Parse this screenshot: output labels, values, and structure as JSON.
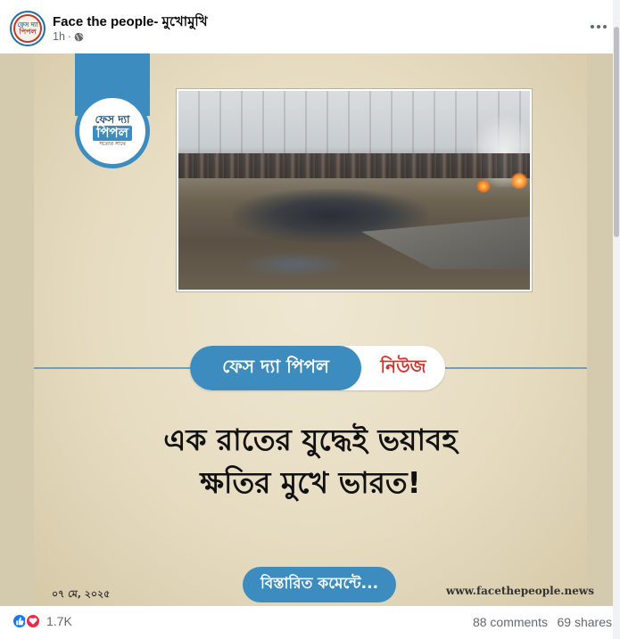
{
  "post": {
    "page_name": "Face the people- মুখোমুখি",
    "time": "1h",
    "audience_icon": "globe-icon",
    "more_icon": "more-options-icon"
  },
  "image": {
    "logo": {
      "line1": "ফেস দ্যা",
      "line2": "পিপল",
      "line3": "সত্যের সাথে"
    },
    "news_label_left": "ফেস দ্যা পিপল",
    "news_label_right": "নিউজ",
    "headline_line1": "এক রাতের যুদ্ধেই ভয়াবহ",
    "headline_line2": "ক্ষতির মুখে ভারত!",
    "date": "০৭ মে, ২০২৫",
    "cta": "বিস্তারিত কমেন্টে...",
    "website": "www.facethepeople.news"
  },
  "footer": {
    "reaction_count": "1.7K",
    "comments": "88 comments",
    "shares": "69 shares"
  },
  "colors": {
    "brand_blue": "#3d8cbf",
    "news_red": "#d0312d",
    "like_blue": "#1877f2",
    "love_red": "#f02849"
  }
}
